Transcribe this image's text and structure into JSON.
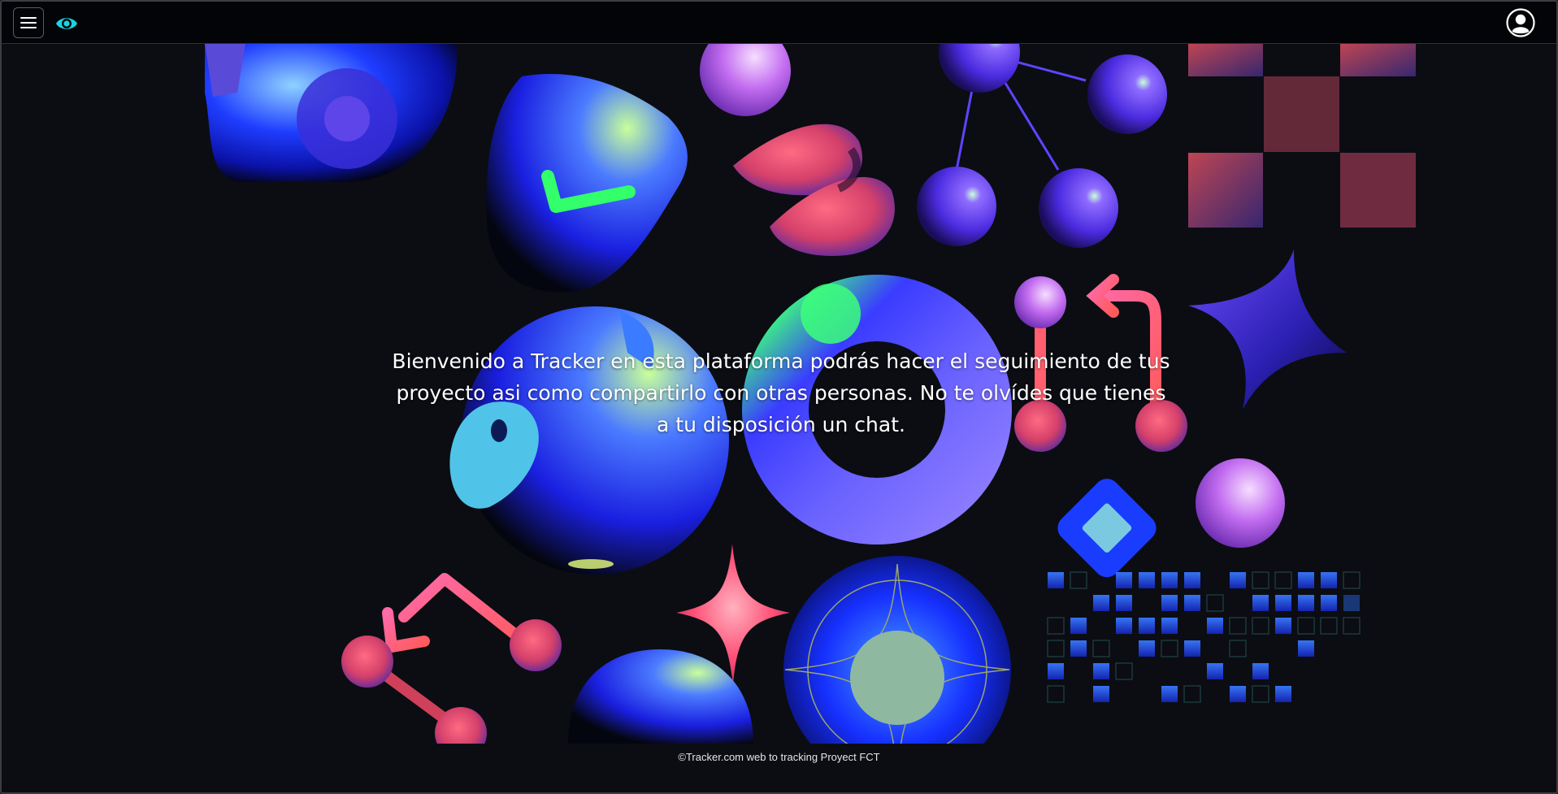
{
  "navbar": {
    "menu_icon": "hamburger-menu-icon",
    "logo_icon": "eye-icon",
    "profile_icon": "user-circle-icon",
    "accent_color": "#19d3e3"
  },
  "hero": {
    "welcome_text": "Bienvenido a Tracker en esta plataforma podrás hacer el seguimiento de tus proyecto asi como compartirlo con otras personas. No te olvídes que tienes a tu disposición un chat."
  },
  "footer": {
    "text": "©Tracker.com web to tracking Proyect FCT"
  }
}
